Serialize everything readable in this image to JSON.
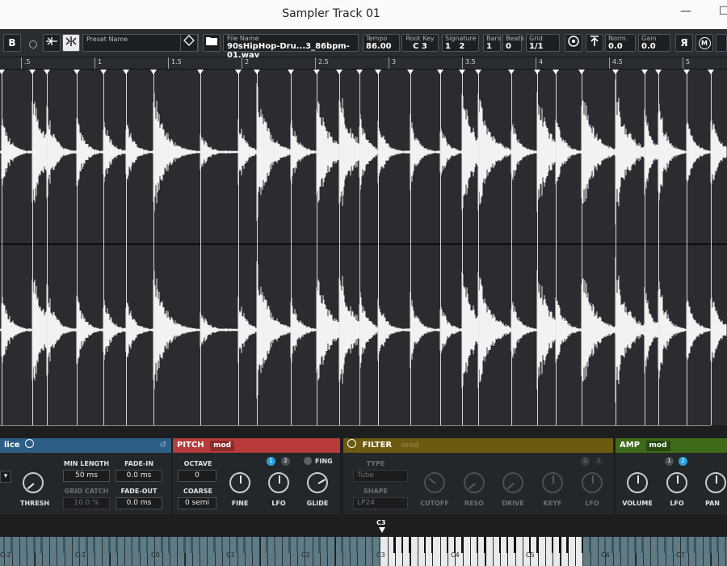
{
  "window": {
    "title": "Sampler Track 01",
    "minimize": "—",
    "restore": "☐"
  },
  "toolbar": {
    "b_button": "B",
    "preset": {
      "caption": "Preset Name",
      "value": ""
    },
    "file": {
      "caption": "File Name",
      "value": "90sHipHop-Dru...3_86bpm-01.wav"
    },
    "tempo": {
      "caption": "Tempo",
      "value": "86.00"
    },
    "root_key": {
      "caption": "Root Key",
      "value": "C 3"
    },
    "signature": {
      "caption": "Signature",
      "num": "1",
      "den": "2"
    },
    "bars": {
      "caption": "Bars",
      "value": "1"
    },
    "beats": {
      "caption": "Beats",
      "value": "0"
    },
    "grid": {
      "caption": "Grid",
      "value": "1/1"
    },
    "norm": {
      "caption": "Norm.",
      "value": "0.0"
    },
    "gain": {
      "caption": "Gain",
      "value": "0.0"
    },
    "reverse_button": "Я",
    "m_button": "M"
  },
  "ruler": {
    "labels": [
      ".5",
      "1",
      "1.5",
      "2",
      "2.5",
      "3",
      "3.5",
      "4",
      "4.5",
      "5"
    ]
  },
  "slice": {
    "title": "lice",
    "min_length_label": "MIN LENGTH",
    "min_length_value": "50 ms",
    "fade_in_label": "FADE-IN",
    "fade_in_value": "0.0 ms",
    "grid_catch_label": "GRID CATCH",
    "grid_catch_value": "10.0 %",
    "fade_out_label": "FADE-OUT",
    "fade_out_value": "0.0 ms",
    "thresh_label": "THRESH"
  },
  "pitch": {
    "title": "PITCH",
    "mod": "mod",
    "octave_label": "OCTAVE",
    "octave_value": "0",
    "coarse_label": "COARSE",
    "coarse_value": "0 semi",
    "fine_label": "FINE",
    "lfo_label": "LFO",
    "glide_label": "GLIDE",
    "fing_label": "FING",
    "lfo1": "1",
    "lfo2": "2"
  },
  "filter": {
    "title": "FILTER",
    "mod": "mod",
    "type_label": "TYPE",
    "type_value": "Tube",
    "shape_label": "SHAPE",
    "shape_value": "LP24",
    "cutoff_label": "CUTOFF",
    "reso_label": "RESO",
    "drive_label": "DRIVE",
    "keyf_label": "KEYF",
    "lfo_label": "LFO",
    "lfo1": "1",
    "lfo2": "2"
  },
  "amp": {
    "title": "AMP",
    "mod": "mod",
    "volume_label": "VOLUME",
    "lfo_label": "LFO",
    "pan_label": "PAN",
    "lfo1": "1",
    "lfo2": "2"
  },
  "keyboard": {
    "root_marker": "C3",
    "octave_labels": [
      "C-2",
      "C-1",
      "C0",
      "C1",
      "C2",
      "C3",
      "C4",
      "C5",
      "C6",
      "C7"
    ]
  },
  "colors": {
    "pitch": "#b83a3a",
    "filter": "#6b5a10",
    "amp": "#3f6b1a",
    "slice": "#2d5f86",
    "accent": "#2a9fd8"
  }
}
